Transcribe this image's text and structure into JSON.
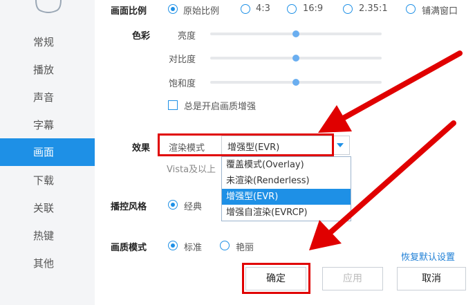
{
  "sidebar": {
    "items": [
      {
        "label": "常规"
      },
      {
        "label": "播放"
      },
      {
        "label": "声音"
      },
      {
        "label": "字幕"
      },
      {
        "label": "画面"
      },
      {
        "label": "下载"
      },
      {
        "label": "关联"
      },
      {
        "label": "热键"
      },
      {
        "label": "其他"
      }
    ],
    "active_index": 4
  },
  "aspect": {
    "label": "画面比例",
    "options": [
      "原始比例",
      "4:3",
      "16:9",
      "2.35:1",
      "铺满窗口"
    ],
    "selected_index": 0
  },
  "color": {
    "label": "色彩",
    "sliders": [
      {
        "label": "亮度",
        "value": 0.5
      },
      {
        "label": "对比度",
        "value": 0.5
      },
      {
        "label": "饱和度",
        "value": 0.5
      }
    ],
    "always_enhance_label": "总是开启画质增强",
    "always_enhance_checked": false
  },
  "effect": {
    "label": "效果",
    "mode_label": "渲染模式",
    "mode_value": "增强型(EVR)",
    "note": "Vista及以上",
    "options": [
      "覆盖模式(Overlay)",
      "未渲染(Renderless)",
      "增强型(EVR)",
      "增强自渲染(EVRCP)"
    ],
    "selected_index": 2
  },
  "control_style": {
    "label": "播控风格",
    "options": [
      "经典"
    ],
    "selected_index": 0
  },
  "quality": {
    "label": "画质模式",
    "options": [
      "标准",
      "艳丽"
    ],
    "selected_index": 0
  },
  "restore_link": "恢复默认设置",
  "buttons": {
    "ok": "确定",
    "apply": "应用",
    "cancel": "取消"
  },
  "colors": {
    "accent": "#1e90e6",
    "annotation": "#e00000"
  }
}
